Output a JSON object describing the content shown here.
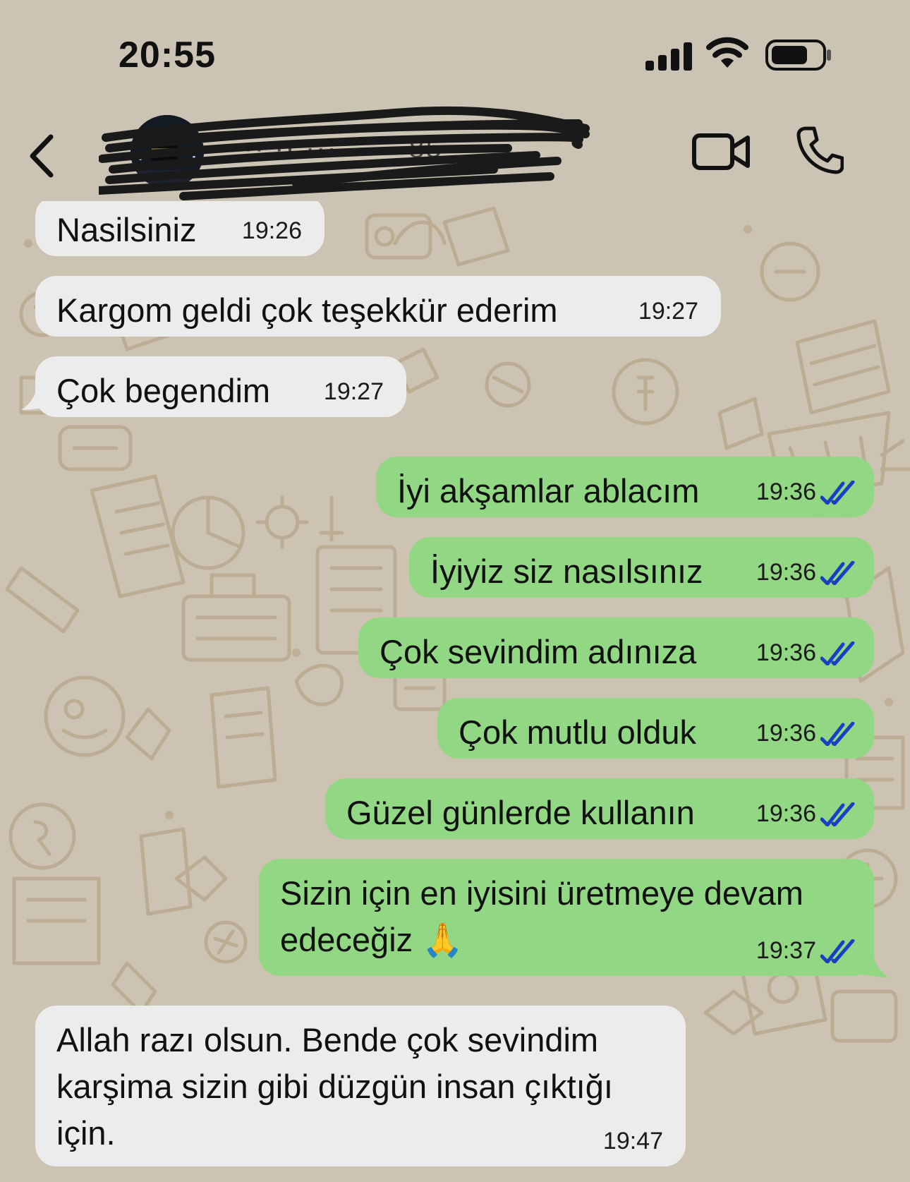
{
  "status_bar": {
    "time": "20:55",
    "signal_icon": "cellular-signal-icon",
    "wifi_icon": "wifi-icon",
    "battery_icon": "battery-icon"
  },
  "header": {
    "back_icon": "chevron-left-icon",
    "contact_name_obscured": "··· ·· ··· ·· ·· 85",
    "video_icon": "video-camera-icon",
    "call_icon": "phone-icon"
  },
  "colors": {
    "incoming_bubble": "#ececec",
    "outgoing_bubble": "#92d783",
    "read_ticks": "#1a3fc4",
    "wallpaper": "#cdc3b2"
  },
  "messages": [
    {
      "direction": "in",
      "text": "Nasilsiniz",
      "time": "19:26"
    },
    {
      "direction": "in",
      "text": "Kargom geldi çok teşekkür ederim",
      "time": "19:27"
    },
    {
      "direction": "in",
      "text": "Çok begendim",
      "time": "19:27"
    },
    {
      "direction": "out",
      "text": "İyi akşamlar ablacım",
      "time": "19:36",
      "status": "read"
    },
    {
      "direction": "out",
      "text": "İyiyiz siz nasılsınız",
      "time": "19:36",
      "status": "read"
    },
    {
      "direction": "out",
      "text": "Çok sevindim adınıza",
      "time": "19:36",
      "status": "read"
    },
    {
      "direction": "out",
      "text": "Çok mutlu olduk",
      "time": "19:36",
      "status": "read"
    },
    {
      "direction": "out",
      "text": "Güzel günlerde kullanın",
      "time": "19:36",
      "status": "read"
    },
    {
      "direction": "out",
      "text": "Sizin için en iyisini üretmeye devam edeceğiz 🙏",
      "time": "19:37",
      "status": "read"
    },
    {
      "direction": "in",
      "text": "Allah razı olsun. Bende çok sevindim karşima sizin gibi düzgün insan çıktığı için.",
      "time": "19:47"
    }
  ]
}
